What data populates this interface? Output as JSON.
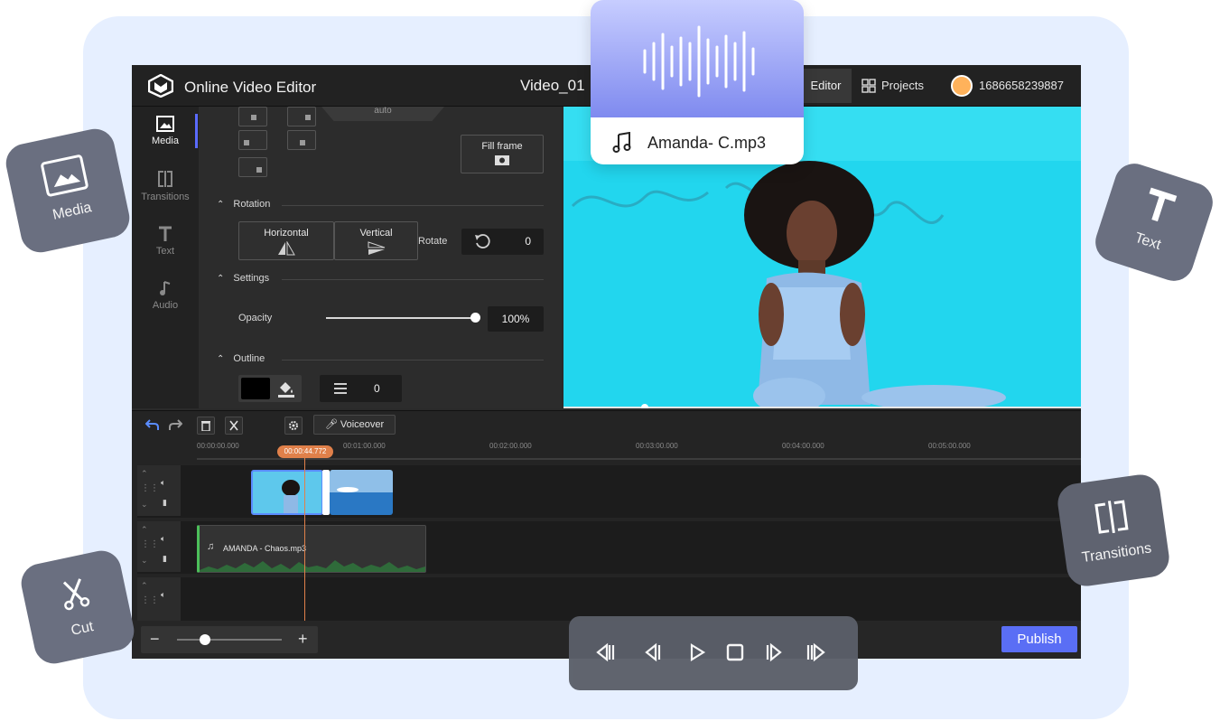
{
  "app": {
    "title": "Online Video Editor",
    "video_name": "Video_01",
    "tabs": {
      "editor": "Editor",
      "projects": "Projects"
    },
    "user_id": "1686658239887"
  },
  "sidebar": {
    "items": [
      {
        "label": "Media",
        "icon": "image-icon",
        "active": true
      },
      {
        "label": "Transitions",
        "icon": "transitions-icon",
        "active": false
      },
      {
        "label": "Text",
        "icon": "text-icon",
        "active": false
      },
      {
        "label": "Audio",
        "icon": "music-note-icon",
        "active": false
      }
    ]
  },
  "properties": {
    "auto_label": "auto",
    "fill_frame": "Fill frame",
    "rotation": {
      "section": "Rotation",
      "horizontal": "Horizontal",
      "vertical": "Vertical",
      "rotate_label": "Rotate",
      "rotate_value": "0"
    },
    "settings": {
      "section": "Settings",
      "opacity_label": "Opacity",
      "opacity_value": "100%",
      "opacity_fraction": 1.0
    },
    "outline": {
      "section": "Outline",
      "color": "#000000",
      "width_value": "0"
    }
  },
  "timeline": {
    "voiceover": "Voiceover",
    "playhead_time": "00:00:44.772",
    "ruler_labels": [
      "00:00:00.000",
      "00:01:00.000",
      "00:02:00.000",
      "00:03:00.000",
      "00:04:00.000",
      "00:05:00.000"
    ],
    "audio_clip": "AMANDA - Chaos.mp3",
    "zoom_level": 0.25
  },
  "publish": "Publish",
  "floating": {
    "audio_file": "Amanda- C.mp3",
    "tiles": {
      "media": "Media",
      "text": "Text",
      "transitions": "Transitions",
      "cut": "Cut"
    }
  },
  "colors": {
    "accent": "#5a6ef5",
    "playhead": "#e0804a",
    "preview_bg": "#20d8f0",
    "background": "#e6efff"
  }
}
